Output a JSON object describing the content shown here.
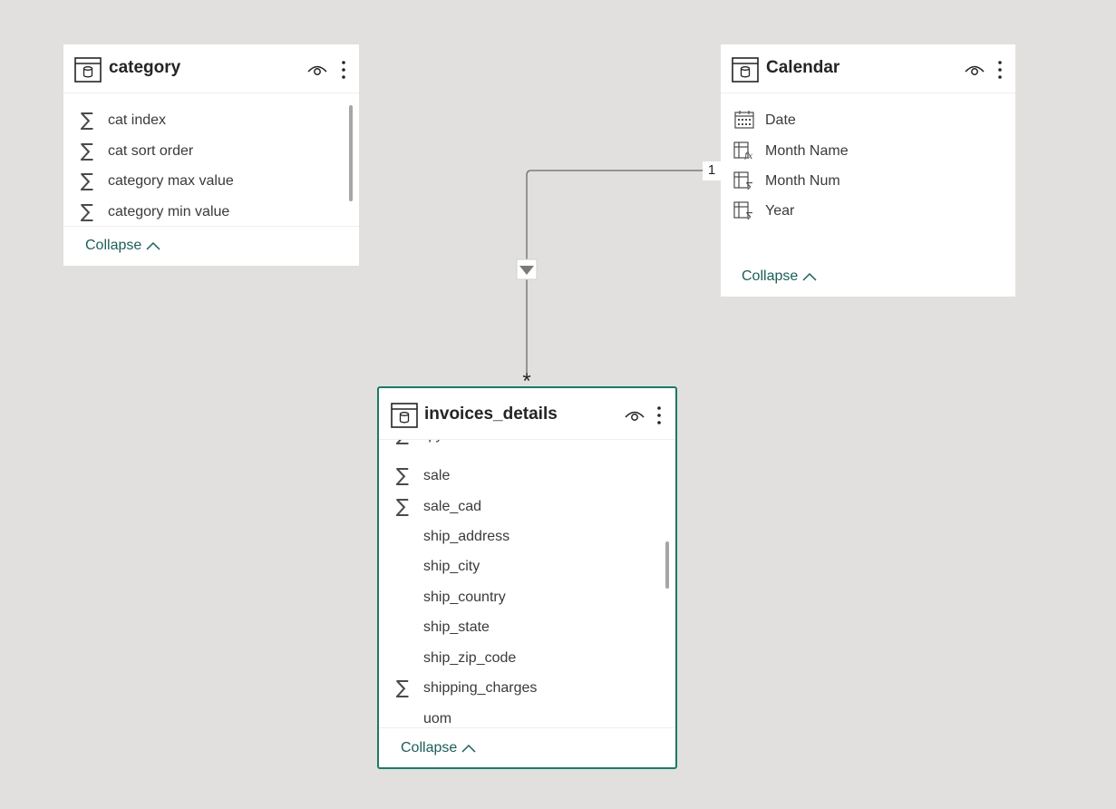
{
  "tables": {
    "category": {
      "title": "category",
      "fields": [
        {
          "name": "cat index",
          "icon": "sigma-icon"
        },
        {
          "name": "cat sort order",
          "icon": "sigma-icon"
        },
        {
          "name": "category max value",
          "icon": "sigma-icon"
        },
        {
          "name": "category min value",
          "icon": "sigma-icon"
        }
      ],
      "collapse_label": "Collapse"
    },
    "calendar": {
      "title": "Calendar",
      "fields": [
        {
          "name": "Date",
          "icon": "calendar-icon"
        },
        {
          "name": "Month Name",
          "icon": "calculated-column-icon"
        },
        {
          "name": "Month Num",
          "icon": "calculated-sum-column-icon"
        },
        {
          "name": "Year",
          "icon": "calculated-sum-column-icon"
        }
      ],
      "collapse_label": "Collapse"
    },
    "invoices_details": {
      "title": "invoices_details",
      "fields": [
        {
          "name": "qty",
          "icon": "sigma-icon"
        },
        {
          "name": "sale",
          "icon": "sigma-icon"
        },
        {
          "name": "sale_cad",
          "icon": "sigma-icon"
        },
        {
          "name": "ship_address",
          "icon": "none"
        },
        {
          "name": "ship_city",
          "icon": "none"
        },
        {
          "name": "ship_country",
          "icon": "none"
        },
        {
          "name": "ship_state",
          "icon": "none"
        },
        {
          "name": "ship_zip_code",
          "icon": "none"
        },
        {
          "name": "shipping_charges",
          "icon": "sigma-icon"
        },
        {
          "name": "uom",
          "icon": "none"
        }
      ],
      "collapse_label": "Collapse"
    }
  },
  "relationship": {
    "from_table": "Calendar",
    "to_table": "invoices_details",
    "one_side_label": "1",
    "many_side_label": "*",
    "filter_direction": "single",
    "line_color": "#7a7a7a"
  },
  "colors": {
    "canvas": "#e1e0de",
    "card": "#ffffff",
    "selected_border": "#1b7a68",
    "collapse_link": "#1b5e5a"
  }
}
